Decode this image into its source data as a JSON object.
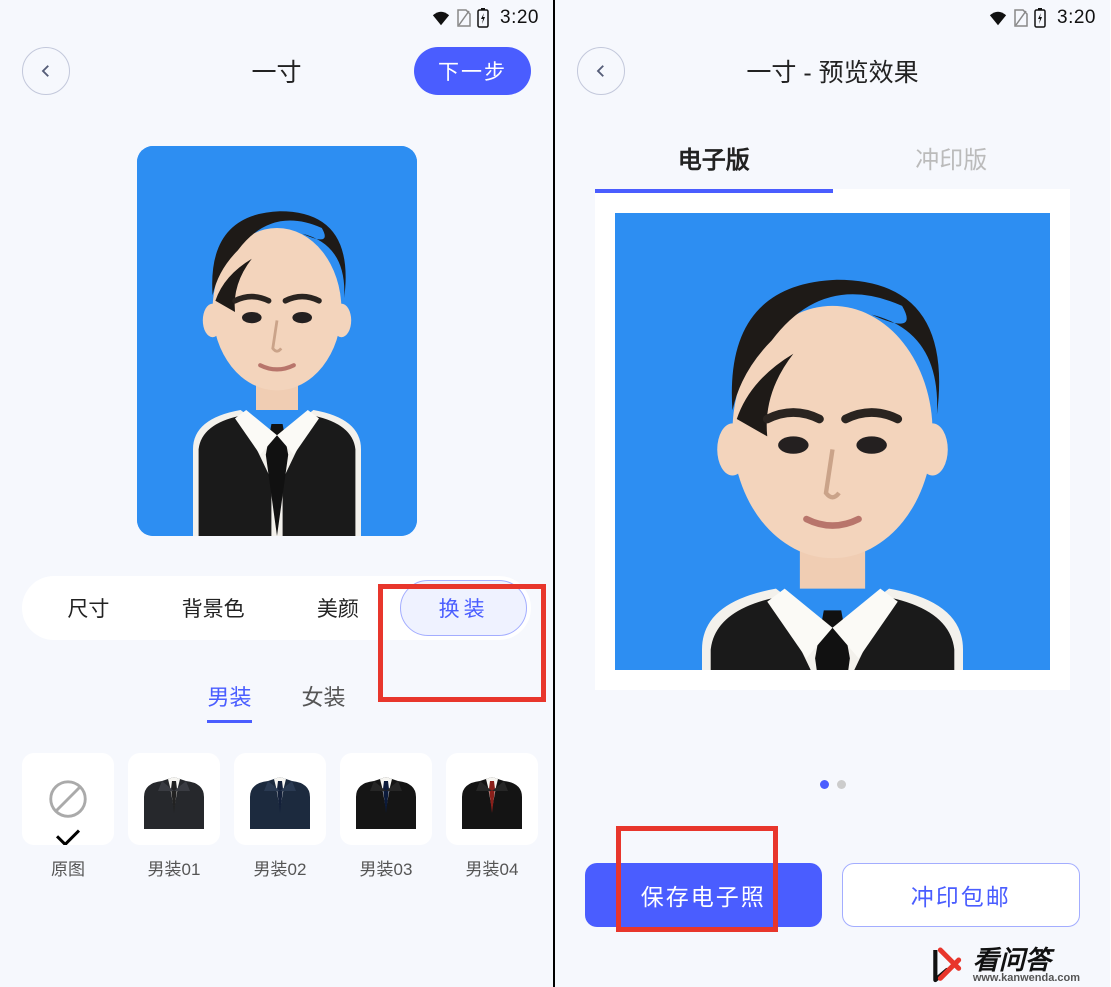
{
  "statusbar": {
    "time": "3:20"
  },
  "screen1": {
    "header": {
      "title": "一寸",
      "next_label": "下一步"
    },
    "tools": {
      "size": "尺寸",
      "bgcolor": "背景色",
      "beauty": "美颜",
      "outfit": "换装"
    },
    "gender": {
      "male": "男装",
      "female": "女装"
    },
    "outfits": {
      "original": "原图",
      "m1": "男装01",
      "m2": "男装02",
      "m3": "男装03",
      "m4": "男装04"
    }
  },
  "screen2": {
    "header": {
      "title": "一寸 - 预览效果"
    },
    "tabs": {
      "digital": "电子版",
      "print": "冲印版"
    },
    "actions": {
      "save": "保存电子照",
      "ship": "冲印包邮"
    }
  },
  "watermark": {
    "cn": "看问答",
    "en": "www.kanwenda.com"
  }
}
